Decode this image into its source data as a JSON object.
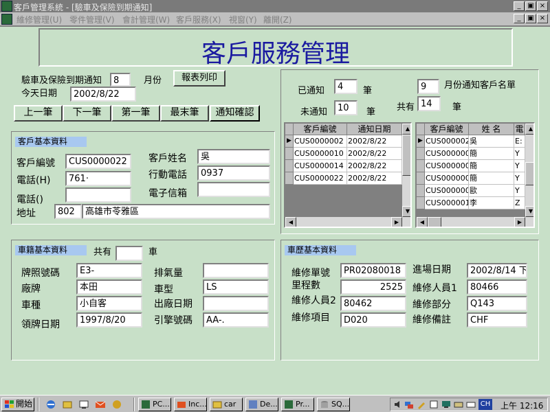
{
  "window": {
    "title": "客戶管理系統 - [驗車及保險到期通知]",
    "controls": [
      "_",
      "▣",
      "×"
    ]
  },
  "menu": [
    "維修管理(U)",
    "零件管理(V)",
    "會計管理(W)",
    "客戶服務(X)",
    "視窗(Y)",
    "離開(Z)"
  ],
  "banner": {
    "title": "客戶服務管理"
  },
  "top_left": {
    "expiry_label": "驗車及保險到期通知",
    "expiry_value": "8",
    "month_label": "月份",
    "print_button": "報表列印",
    "today_label": "今天日期",
    "today_value": "2002/8/22",
    "nav": [
      "上一筆",
      "下一筆",
      "第一筆",
      "最末筆",
      "通知確認"
    ]
  },
  "customer": {
    "section_title": "客戶基本資料",
    "id_label": "客戶編號",
    "id_value": "CUS0000022",
    "name_label": "客戶姓名",
    "name_value": "吳",
    "phone_h_label": "電話(H)",
    "phone_h_value": "761·",
    "mobile_label": "行動電話",
    "mobile_value": "0937",
    "phone_o_label": "電話()",
    "phone_o_value": "",
    "email_label": "電子信箱",
    "email_value": "",
    "address_label": "地址",
    "zip_value": "802",
    "address_value": "高雄市苓雅區"
  },
  "notify": {
    "notified_label": "已通知",
    "notified_value": "4",
    "unit": "筆",
    "not_notified_label": "未通知",
    "not_notified_value": "10",
    "month_value": "9",
    "month_list_label": "月份通知客戶名單",
    "total_label": "共有",
    "total_value": "14"
  },
  "grid_notified": {
    "headers": [
      "客戶編號",
      "通知日期"
    ],
    "rows": [
      [
        "CUS0000002",
        "2002/8/22"
      ],
      [
        "CUS0000010",
        "2002/8/22"
      ],
      [
        "CUS0000014",
        "2002/8/22"
      ],
      [
        "CUS0000022",
        "2002/8/22"
      ]
    ]
  },
  "grid_customers": {
    "headers": [
      "客戶編號",
      "姓 名",
      "電"
    ],
    "rows": [
      [
        "CUS0000022",
        "吳",
        "E:"
      ],
      [
        "CUS0000001",
        "簡",
        "Y"
      ],
      [
        "CUS0000001",
        "簡",
        "Y"
      ],
      [
        "CUS0000001",
        "簡",
        "Y"
      ],
      [
        "CUS0000002",
        "歐",
        "Y"
      ],
      [
        "CUS0000010",
        "李",
        "Z"
      ]
    ]
  },
  "vehicle": {
    "section_title": "車籍基本資料",
    "count_label": "共有",
    "count_value": "",
    "count_unit": "車",
    "plate_label": "牌照號碼",
    "plate_value": "E3-",
    "displacement_label": "排氣量",
    "displacement_value": "",
    "brand_label": "廠牌",
    "brand_value": "本田",
    "model_label": "車型",
    "model_value": "LS",
    "type_label": "車種",
    "type_value": "小自客",
    "mfg_label": "出廠日期",
    "mfg_value": "",
    "license_label": "領牌日期",
    "license_value": "1997/8/20",
    "engine_label": "引擎號碼",
    "engine_value": "AA-."
  },
  "history": {
    "section_title": "車歷基本資料",
    "order_label": "維修單號",
    "order_value": "PR02080018",
    "entry_label": "進場日期",
    "entry_value": "2002/8/14 下",
    "mileage_label": "里程數",
    "mileage_value": "2525",
    "staff1_label": "維修人員1",
    "staff1_value": "80466",
    "staff2_label": "維修人員2",
    "staff2_value": "80462",
    "part_label": "維修部分",
    "part_value": "Q143",
    "item_label": "維修項目",
    "item_value": "D020",
    "note_label": "維修備註",
    "note_value": "CHF"
  },
  "taskbar": {
    "start": "開始",
    "tasks": [
      "PC...",
      "Inc...",
      "car",
      "De...",
      "Pr...",
      "SQ..."
    ],
    "ime": "CH",
    "clock": "上午 12:16"
  },
  "colors": {
    "client_bg": "#c8e0c8",
    "banner_text": "#1a1aa0",
    "section_title_bg": "#a8c8f0"
  }
}
